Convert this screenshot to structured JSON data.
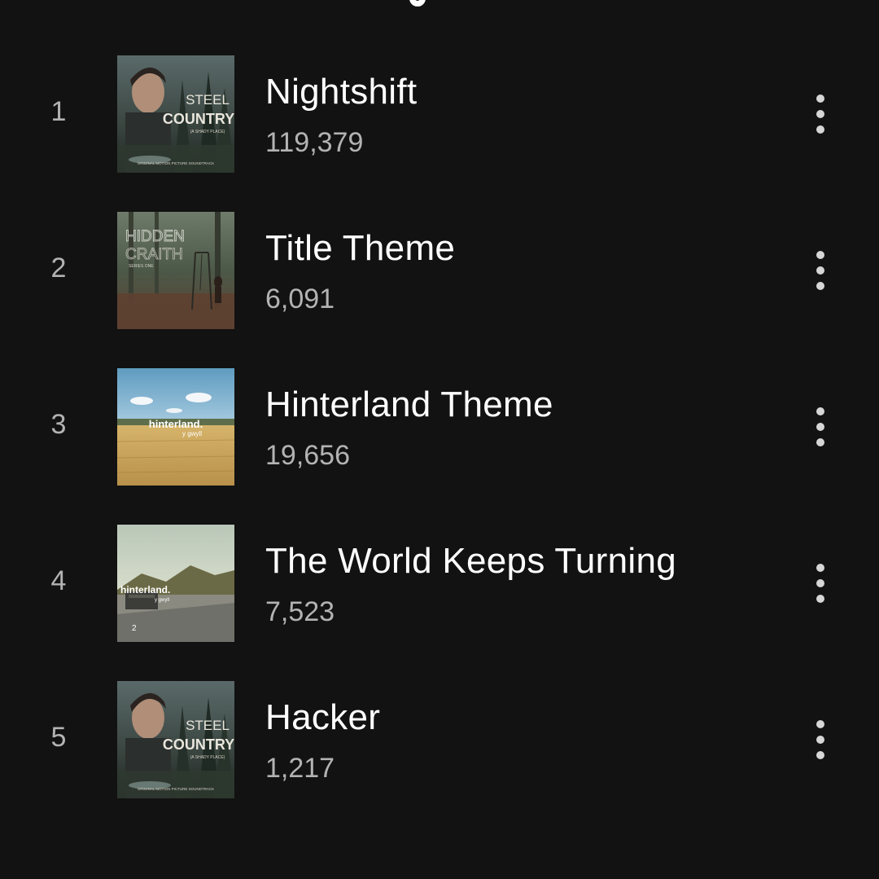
{
  "tracks": [
    {
      "rank": "1",
      "title": "Nightshift",
      "plays": "119,379",
      "art": "steel-country",
      "art_text": [
        "STEEL",
        "COUNTRY",
        "(A SHADY PLACE)",
        "ORIGINAL MOTION PICTURE SOUNDTRACK"
      ]
    },
    {
      "rank": "2",
      "title": "Title Theme",
      "plays": "6,091",
      "art": "hidden-craith",
      "art_text": [
        "HIDDEN",
        "CRAITH",
        "SERIES ONE"
      ]
    },
    {
      "rank": "3",
      "title": "Hinterland Theme",
      "plays": "19,656",
      "art": "hinterland-field",
      "art_text": [
        "hinterland.",
        "y gwyll"
      ]
    },
    {
      "rank": "4",
      "title": "The World Keeps Turning",
      "plays": "7,523",
      "art": "hinterland-road",
      "art_text": [
        "hinterland.",
        "y gwyll",
        "2"
      ]
    },
    {
      "rank": "5",
      "title": "Hacker",
      "plays": "1,217",
      "art": "steel-country",
      "art_text": [
        "STEEL",
        "COUNTRY",
        "(A SHADY PLACE)",
        "ORIGINAL MOTION PICTURE SOUNDTRACK"
      ]
    }
  ],
  "icons": {
    "more": "more-vertical-icon"
  },
  "colors": {
    "background": "#121212",
    "primary_text": "#ffffff",
    "secondary_text": "#b3b3b3",
    "icon": "#d6d6d6"
  }
}
